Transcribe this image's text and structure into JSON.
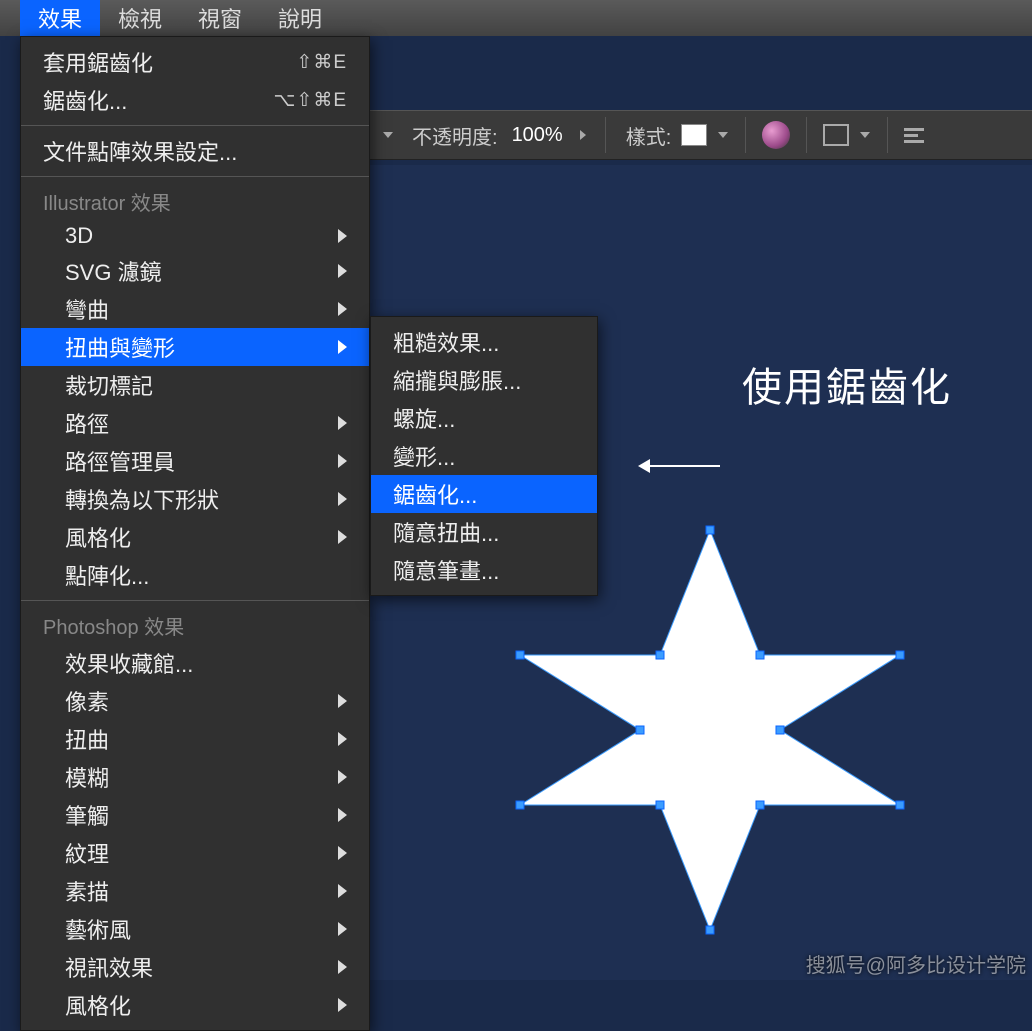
{
  "menubar": {
    "items": [
      "效果",
      "檢視",
      "視窗",
      "說明"
    ],
    "active_index": 0
  },
  "toolbar": {
    "opacity_label": "不透明度:",
    "opacity_value": "100%",
    "style_label": "樣式:"
  },
  "dropdown": {
    "top": [
      {
        "label": "套用鋸齒化",
        "shortcut": "⇧⌘E"
      },
      {
        "label": "鋸齒化...",
        "shortcut": "⌥⇧⌘E"
      }
    ],
    "raster": {
      "label": "文件點陣效果設定..."
    },
    "illustrator_header": "Illustrator 效果",
    "illustrator_items": [
      {
        "label": "3D",
        "arrow": true
      },
      {
        "label": "SVG 濾鏡",
        "arrow": true
      },
      {
        "label": "彎曲",
        "arrow": true
      },
      {
        "label": "扭曲與變形",
        "arrow": true,
        "highlighted": true
      },
      {
        "label": "裁切標記",
        "arrow": false
      },
      {
        "label": "路徑",
        "arrow": true
      },
      {
        "label": "路徑管理員",
        "arrow": true
      },
      {
        "label": "轉換為以下形狀",
        "arrow": true
      },
      {
        "label": "風格化",
        "arrow": true
      },
      {
        "label": "點陣化..."
      }
    ],
    "photoshop_header": "Photoshop 效果",
    "photoshop_items": [
      {
        "label": "效果收藏館..."
      },
      {
        "label": "像素",
        "arrow": true
      },
      {
        "label": "扭曲",
        "arrow": true
      },
      {
        "label": "模糊",
        "arrow": true
      },
      {
        "label": "筆觸",
        "arrow": true
      },
      {
        "label": "紋理",
        "arrow": true
      },
      {
        "label": "素描",
        "arrow": true
      },
      {
        "label": "藝術風",
        "arrow": true
      },
      {
        "label": "視訊效果",
        "arrow": true
      },
      {
        "label": "風格化",
        "arrow": true
      }
    ]
  },
  "submenu": {
    "items": [
      {
        "label": "粗糙效果..."
      },
      {
        "label": "縮攏與膨脹..."
      },
      {
        "label": "螺旋..."
      },
      {
        "label": "變形..."
      },
      {
        "label": "鋸齒化...",
        "highlighted": true
      },
      {
        "label": "隨意扭曲..."
      },
      {
        "label": "隨意筆畫..."
      }
    ]
  },
  "annotation": "使用鋸齒化",
  "watermark": "搜狐号@阿多比设计学院"
}
